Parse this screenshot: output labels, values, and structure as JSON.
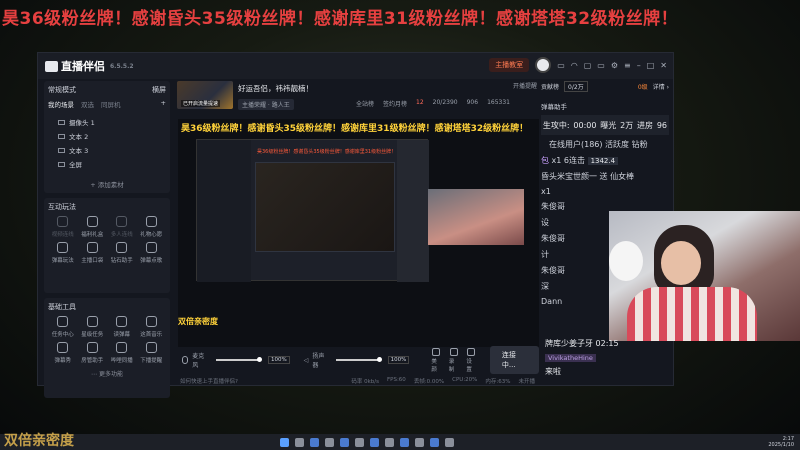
{
  "banner": "昊36级粉丝牌！感谢昏头35级粉丝牌！感谢库里31级粉丝牌！感谢塔塔32级粉丝牌！",
  "app": {
    "logo": "直播伴侣",
    "version": "6.5.5.2",
    "tutorial": "主播教室",
    "icons": [
      "chat-icon",
      "headset-icon",
      "gift-icon",
      "monitor-icon",
      "settings-icon",
      "menu-icon",
      "minimize-icon",
      "maximize-icon",
      "close-icon"
    ]
  },
  "scenes": {
    "mode": "常规模式",
    "orientation": "横屏",
    "tabs": [
      "我的场景",
      "双选",
      "同屏机"
    ],
    "items": [
      "摄像头 1",
      "文本 2",
      "文本 3",
      "全屏"
    ],
    "add_source": "+ 添加素材"
  },
  "interactive": {
    "title": "互动玩法",
    "tools": [
      "视频连线",
      "福利礼盒",
      "多人连线",
      "礼物心愿",
      "弹幕玩法",
      "主播口袋",
      "钻石助手",
      "弹幕点歌"
    ]
  },
  "basic_tools": {
    "title": "基础工具",
    "tools": [
      "任务中心",
      "星级任务",
      "读弹幕",
      "这首音乐",
      "弹幕秀",
      "房管助手",
      "哔哩同播",
      "下播提醒"
    ],
    "more": "更多功能"
  },
  "stream": {
    "title": "好运吾侣，祎祎靓楠！",
    "thumb_label": "已开启流量提速",
    "category": "主播荣耀 · 路人王",
    "stats": [
      "全站榜",
      "签约月榜",
      "12",
      "20/2390",
      "906",
      "165331"
    ],
    "pip_tip": "开播提醒",
    "overlay_text": "昊36级粉丝牌！感谢昏头35级粉丝牌！感谢库里31级粉丝牌！感谢塔塔32级粉丝牌！",
    "inner_text": "昊36级粉丝牌！感谢昏头35级粉丝牌！感谢库里31级粉丝牌！",
    "yellow_text": "双倍亲密度"
  },
  "controls": {
    "mic_label": "麦克风",
    "mic_pct": "100%",
    "speaker_label": "扬声器",
    "speaker_pct": "100%",
    "quick": [
      "美颜",
      "录制",
      "设置"
    ],
    "connect": "连接中..."
  },
  "footer": {
    "help": "如何快速上手直播伴侣?",
    "bitrate": "码率 0kb/s",
    "fps": "FPS:60",
    "drop": "丢帧:0.00%",
    "cpu": "CPU:20%",
    "mem": "内存:63%",
    "status": "未开播"
  },
  "right": {
    "tab": "贡献榜",
    "count": "0/2万",
    "level": "0级",
    "detail": "详情 ›",
    "chat_title": "弹幕助手",
    "battle": [
      "生攻中:",
      "00:00",
      "曝光",
      "2万",
      "进房",
      "96"
    ],
    "online": "在线用户(186) 活跃度 钻粉",
    "messages": [
      {
        "name": "包",
        "text": "x1 6连击",
        "gift": "1342.4"
      },
      {
        "name": "",
        "text": "昏头米宝世颜一 送 仙女棒"
      },
      {
        "name": "",
        "text": "x1"
      },
      {
        "name": "",
        "text": "朱俊哥"
      },
      {
        "name": "",
        "text": "设"
      },
      {
        "name": "",
        "text": "朱俊哥"
      },
      {
        "name": "",
        "text": "计"
      },
      {
        "name": "",
        "text": "朱俊哥"
      },
      {
        "name": "",
        "text": "深"
      },
      {
        "name": "",
        "text": "Dann"
      }
    ],
    "cam_chat": [
      "牌库少姜子牙  02:15",
      "VivikatheHine",
      "来啦"
    ]
  },
  "watermark": "双倍亲密度",
  "taskbar": {
    "time": "2:17",
    "date": "2025/1/10"
  }
}
